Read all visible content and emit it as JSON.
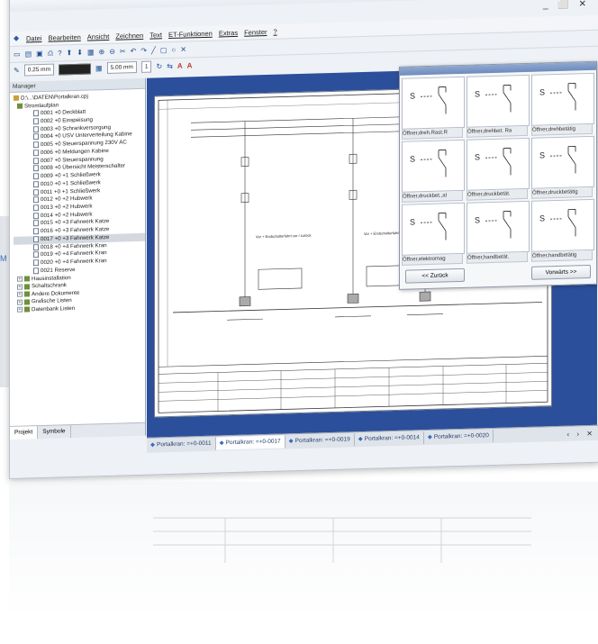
{
  "window": {
    "controls": "_ ⬜ ✕",
    "brand_letter": "M"
  },
  "menu": {
    "items": [
      "Datei",
      "Bearbeiten",
      "Ansicht",
      "Zeichnen",
      "Text",
      "ET-Funktionen",
      "Extras",
      "Fenster",
      "?"
    ]
  },
  "toolbar": {
    "line_width": "0.25 mm",
    "grid": "5.00 mm",
    "layer": "1"
  },
  "manager": {
    "title": "Manager",
    "root": "D:\\...\\DATEN\\Portalkran.cpj",
    "folder": "Stromlaufplan",
    "pages": [
      "0001 +0 Deckblatt",
      "0002 +0 Einspeisung",
      "0003 +0 Schrankversorgung",
      "0004 +0 USV Unterverteilung Kabine",
      "0005 +0 Steuerspannung 230V AC",
      "0006 +0 Meldungen Kabine",
      "0007 +0 Steuerspannung",
      "0008 +0 Übersicht Meisterschalter",
      "0009 +0 +1 Schließwerk",
      "0010 +0 +1 Schließwerk",
      "0011 +0 +1 Schließwerk",
      "0012 +0 +2 Hubwerk",
      "0013 +0 +2 Hubwerk",
      "0014 +0 +2 Hubwerk",
      "0015 +0 +3 Fahrwerk Katze",
      "0016 +0 +3 Fahrwerk Katze",
      "0017 +0 +3 Fahrwerk Katze",
      "0018 +0 +4 Fahrwerk Kran",
      "0019 +0 +4 Fahrwerk Kran",
      "0020 +0 +4 Fahrwerk Kran",
      "0021 Reserve"
    ],
    "other_folders": [
      "Hausinstallation",
      "Schaltschrank",
      "Andere Dokumente",
      "Grafische Listen",
      "Datenbank Listen"
    ],
    "tabs": [
      "Projekt",
      "Symbole"
    ]
  },
  "palette": {
    "symbols": [
      "Öffner,dreh.Rast.R",
      "Öffner,drehbet. Ra",
      "Öffner,drehbetätig",
      "Öffner,druckbet.,al",
      "Öffner,druckbetät.",
      "Öffner,druckbetätig",
      "Öffner,elektromag",
      "Öffner,handbetät.",
      "Öffner,handbetätig"
    ],
    "back_button": "<< Zurück",
    "next_button": "Vorwärts >>"
  },
  "doc_tabs": [
    "Portalkran: =+0-0011",
    "Portalkran: =+0-0017",
    "Portalkran: =+0-0019",
    "Portalkran: =+0-0014",
    "Portalkran: =+0-0020"
  ],
  "doc_tab_nav": "‹ › ✕",
  "sheet": {
    "note_left": "Vor + Endschalterfahrt vor / zurück",
    "note_right": "Vor + Endschalterfahrt vor / zurück"
  },
  "colors": {
    "canvas_bg": "#2c4f9b",
    "accent": "#3a6bbf"
  }
}
